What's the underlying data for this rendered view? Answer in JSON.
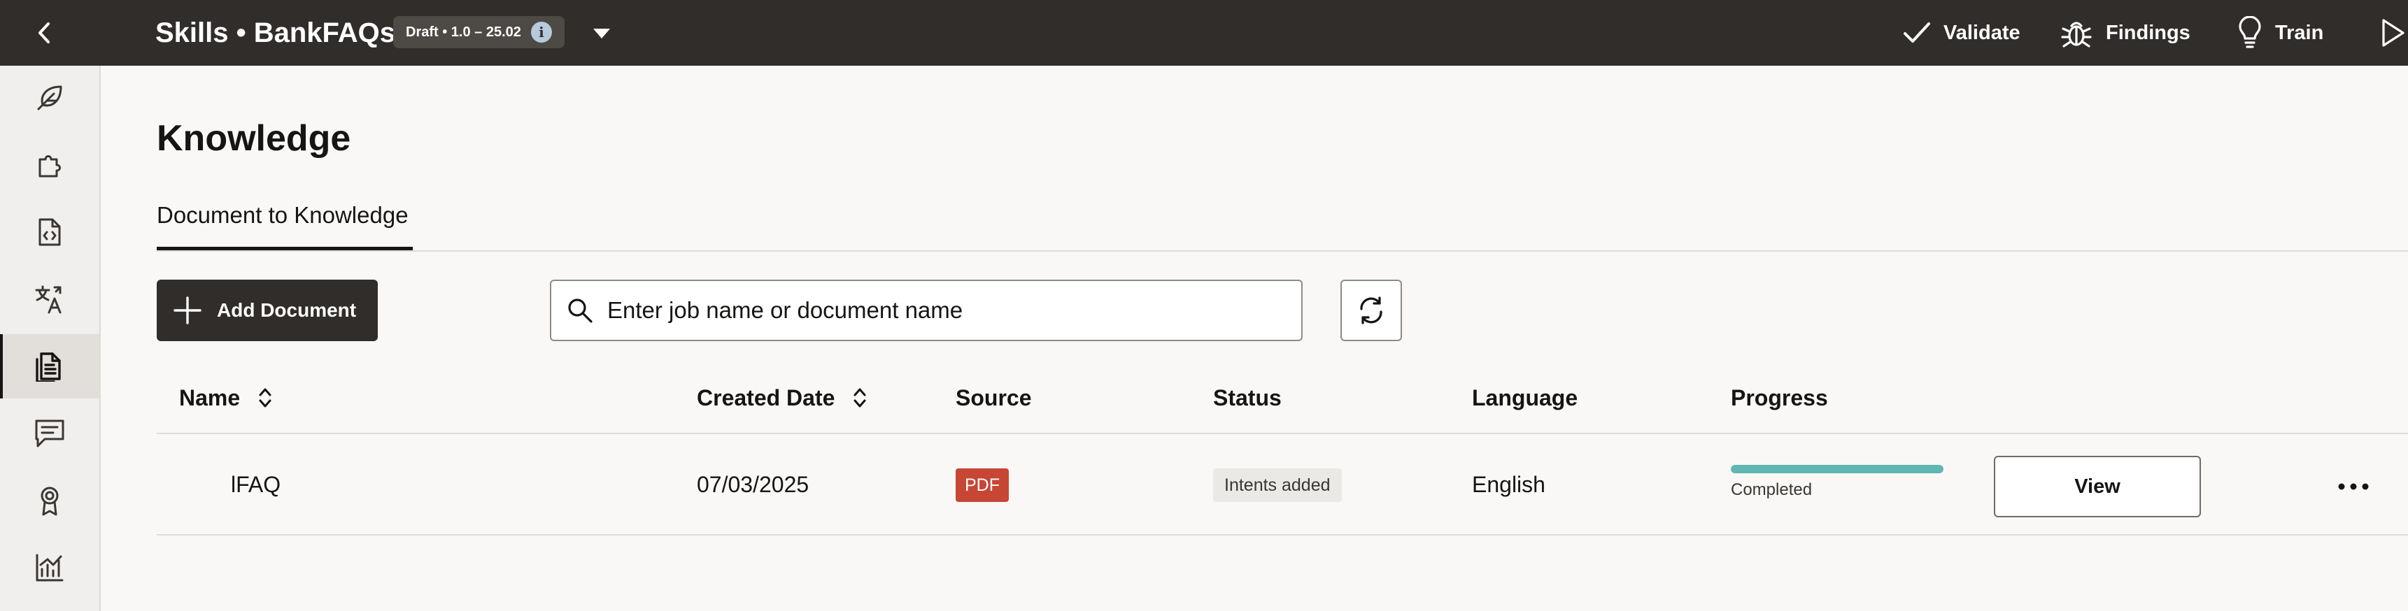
{
  "header": {
    "app_title": "Skills • BankFAQs",
    "version_badge": "Draft • 1.0 – 25.02",
    "actions": [
      {
        "label": "Validate",
        "icon": "check-icon"
      },
      {
        "label": "Findings",
        "icon": "bug-icon"
      },
      {
        "label": "Train",
        "icon": "lightbulb-icon"
      },
      {
        "label": "",
        "icon": "play-icon"
      }
    ]
  },
  "sidebar": {
    "items": [
      {
        "icon": "feather-icon",
        "active": false
      },
      {
        "icon": "puzzle-icon",
        "active": false
      },
      {
        "icon": "code-document-icon",
        "active": false
      },
      {
        "icon": "translate-icon",
        "active": false
      },
      {
        "icon": "knowledge-document-icon",
        "active": true
      },
      {
        "icon": "conversation-icon",
        "active": false
      },
      {
        "icon": "badge-icon",
        "active": false
      },
      {
        "icon": "analytics-icon",
        "active": false
      }
    ]
  },
  "page": {
    "title": "Knowledge",
    "tabs": [
      {
        "label": "Document to Knowledge",
        "selected": true
      }
    ]
  },
  "toolbar": {
    "add_document_label": "Add Document",
    "search_placeholder": "Enter job name or document name",
    "search_value": ""
  },
  "table": {
    "columns": [
      "Name",
      "Created Date",
      "Source",
      "Status",
      "Language",
      "Progress"
    ],
    "rows": [
      {
        "name": "lFAQ",
        "created_date": "07/03/2025",
        "source": "PDF",
        "status": "Intents added",
        "language": "English",
        "progress_percent": 100,
        "progress_label": "Completed",
        "action_label": "View"
      }
    ]
  },
  "colors": {
    "topbar_bg": "#312d2a",
    "pdf_badge": "#c74634",
    "progress_fill": "#5fb6b2"
  }
}
